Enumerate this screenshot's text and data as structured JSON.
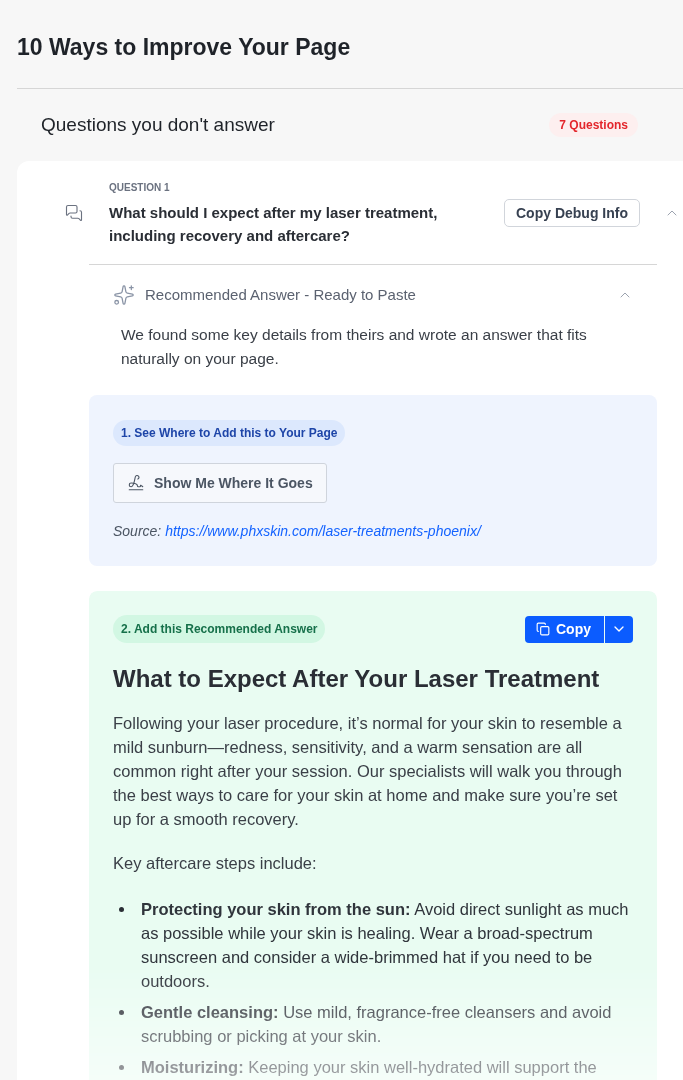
{
  "page": {
    "title": "10 Ways to Improve Your Page"
  },
  "section": {
    "title": "Questions you don't answer",
    "badge": "7 Questions"
  },
  "question": {
    "label": "QUESTION 1",
    "text": "What should I expect after my laser treatment, including recovery and aftercare?",
    "debug_button": "Copy Debug Info",
    "expanded": true,
    "recommended": {
      "title": "Recommended Answer - Ready to Paste",
      "expanded": true,
      "intro": "We found some key details from theirs and wrote an answer that fits naturally on your page.",
      "step_1": {
        "label": "1. See Where to Add this to Your Page",
        "button": "Show Me Where It Goes",
        "source_label": "Source:",
        "source_url": "https://www.phxskin.com/laser-treatments-phoenix/"
      },
      "step_2": {
        "label": "2. Add this Recommended Answer",
        "copy_button": "Copy",
        "heading": "What to Expect After Your Laser Treatment",
        "paragraphs": [
          "Following your laser procedure, it’s normal for your skin to resemble a mild sunburn—redness, sensitivity, and a warm sensation are all common right after your session. Our specialists will walk you through the best ways to care for your skin at home and make sure you’re set up for a smooth recovery.",
          "Key aftercare steps include:"
        ],
        "list": [
          "**Protecting your skin from the sun:** Avoid direct sunlight as much as possible while your skin is healing. Wear a broad-spectrum sunscreen and consider a wide-brimmed hat if you need to be outdoors.",
          "**Gentle cleansing:** Use mild, fragrance-free cleansers and avoid scrubbing or picking at your skin.",
          "**Moisturizing:** Keeping your skin well-hydrated will support the"
        ]
      }
    }
  }
}
